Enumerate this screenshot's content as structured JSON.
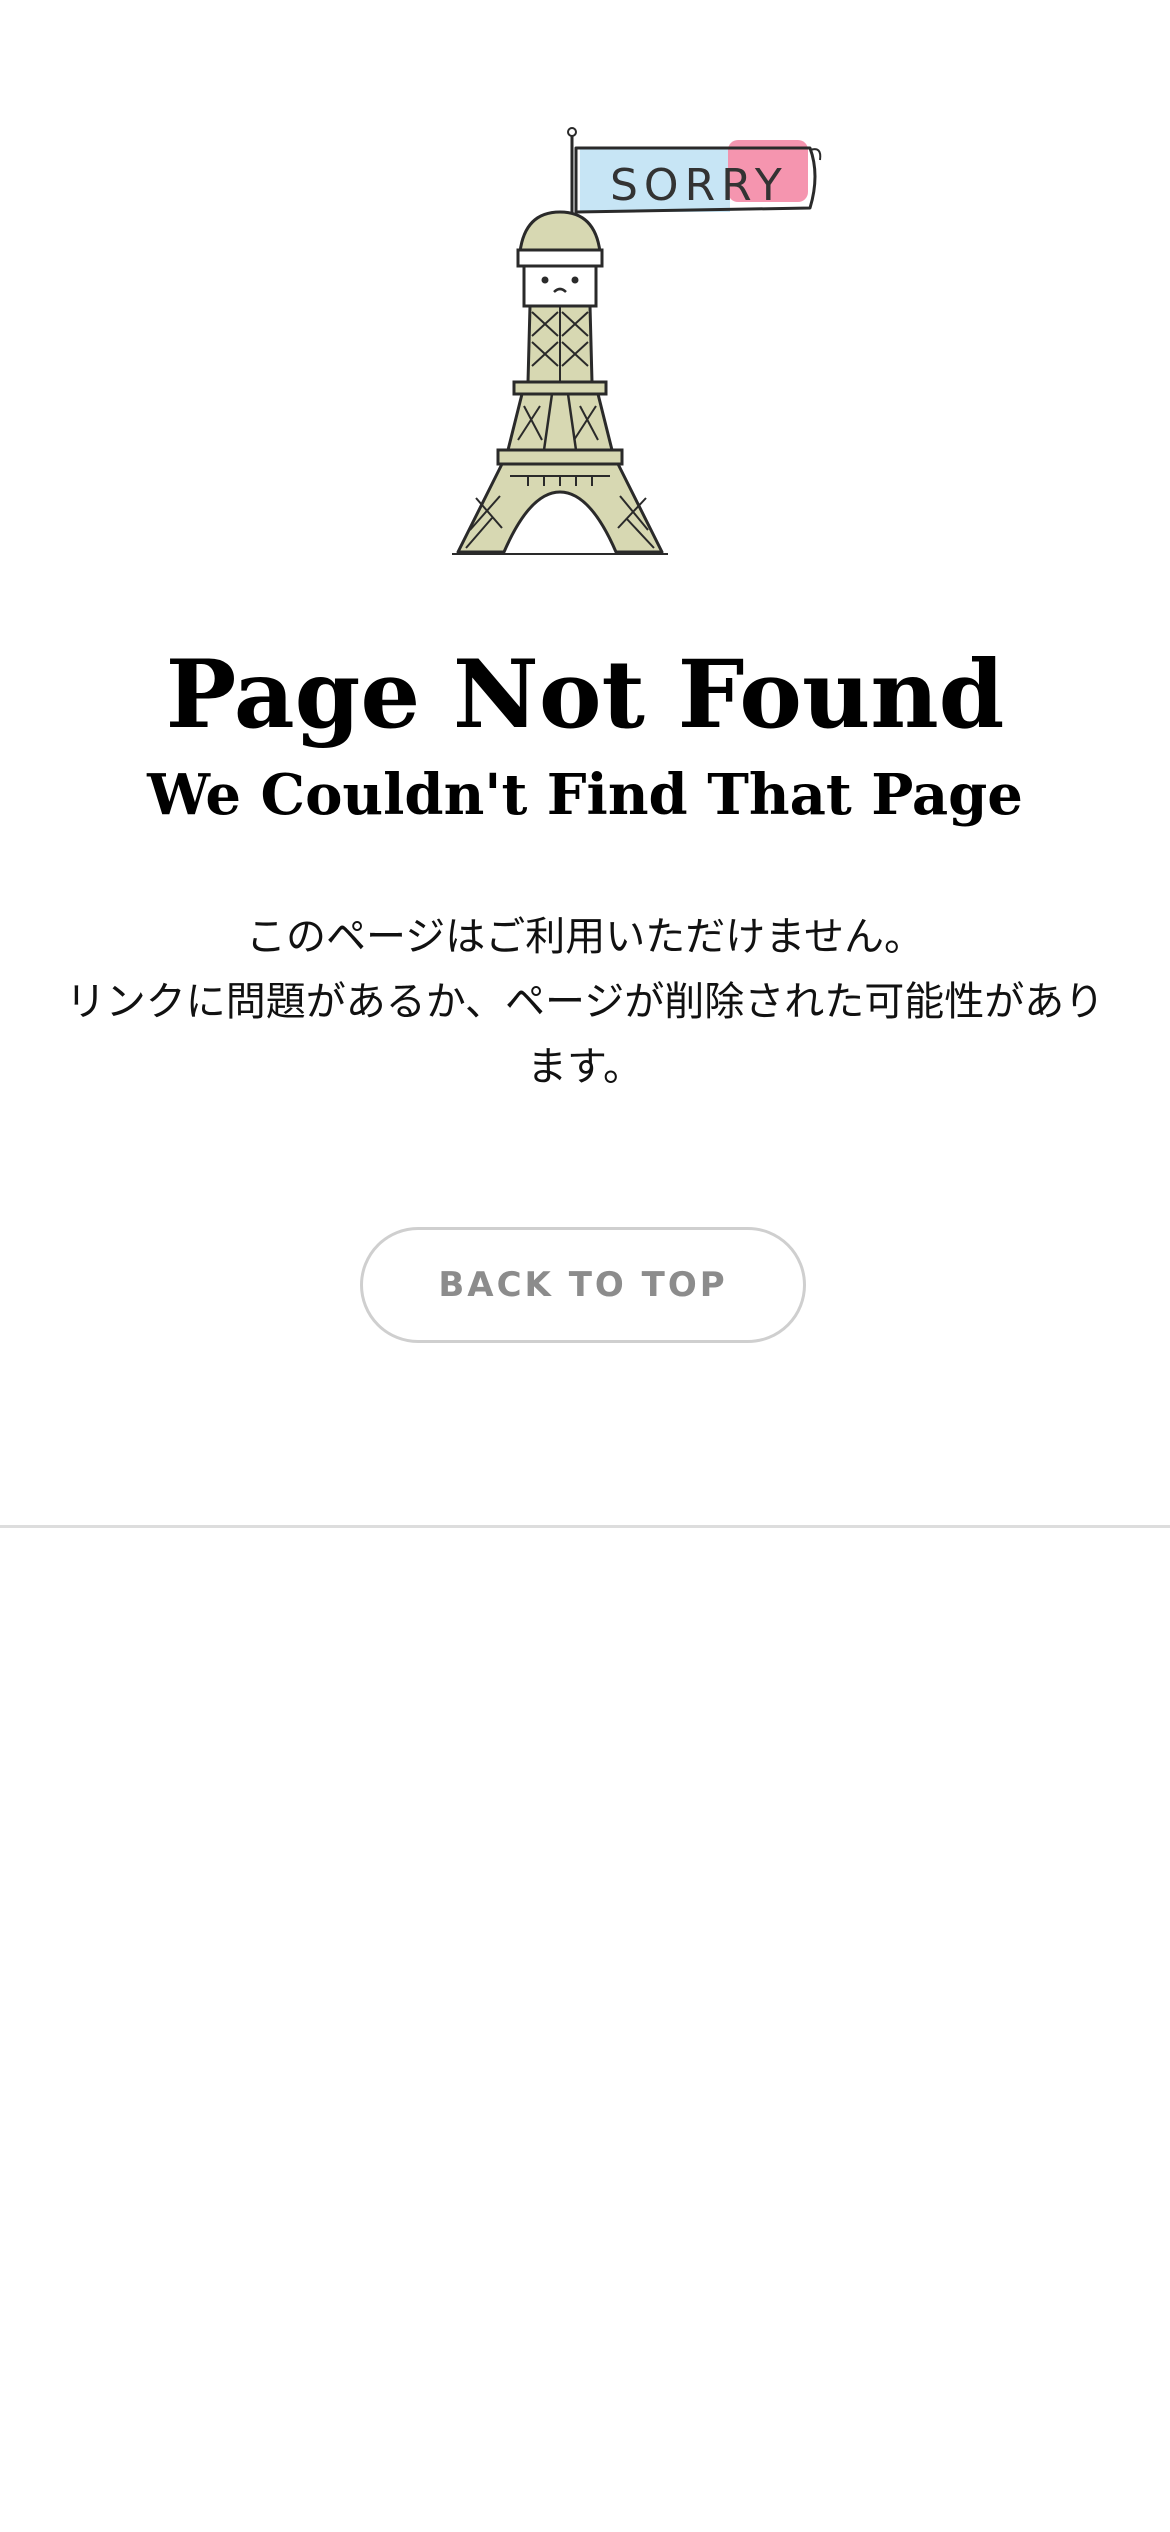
{
  "illustration": {
    "flag_text": "SORRY",
    "colors": {
      "flag_blue": "#c4e4f4",
      "flag_pink": "#f48aa6",
      "tower_fill": "#d7d8b2",
      "outline": "#2a2a2a"
    }
  },
  "heading": {
    "title": "Page Not Found",
    "subtitle": "We Couldn't Find That Page"
  },
  "message": {
    "line1": "このページはご利用いただけません。",
    "line2": "リンクに問題があるか、ページが削除された可能性があります。"
  },
  "actions": {
    "back_to_top_label": "BACK TO TOP"
  },
  "colors": {
    "background": "#ffffff",
    "button_border": "#cfcfcf",
    "button_text": "#8c8c8c",
    "divider": "#dddddd"
  }
}
